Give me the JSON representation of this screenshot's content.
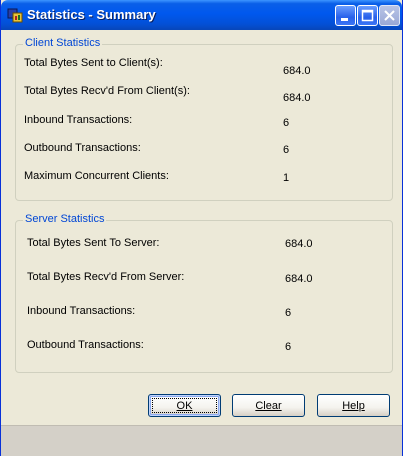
{
  "window": {
    "title": "Statistics - Summary",
    "icon": "statistics-app-icon"
  },
  "client_stats": {
    "group_title": "Client Statistics",
    "rows": [
      {
        "label": "Total Bytes Sent to Client(s):",
        "value": "684.0"
      },
      {
        "label": "Total Bytes Recv'd From Client(s):",
        "value": "684.0"
      },
      {
        "label": "Inbound Transactions:",
        "value": "6"
      },
      {
        "label": "Outbound Transactions:",
        "value": "6"
      },
      {
        "label": "Maximum Concurrent Clients:",
        "value": "1"
      }
    ]
  },
  "server_stats": {
    "group_title": "Server Statistics",
    "rows": [
      {
        "label": "Total Bytes Sent To Server:",
        "value": "684.0"
      },
      {
        "label": "Total Bytes Recv'd From Server:",
        "value": "684.0"
      },
      {
        "label": "Inbound Transactions:",
        "value": "6"
      },
      {
        "label": "Outbound Transactions:",
        "value": "6"
      }
    ]
  },
  "buttons": {
    "ok": "OK",
    "clear": "Clear",
    "help": "Help"
  },
  "colors": {
    "title_bar": "#0058ee",
    "group_title": "#0046d5",
    "dialog_bg": "#ece9d8"
  }
}
